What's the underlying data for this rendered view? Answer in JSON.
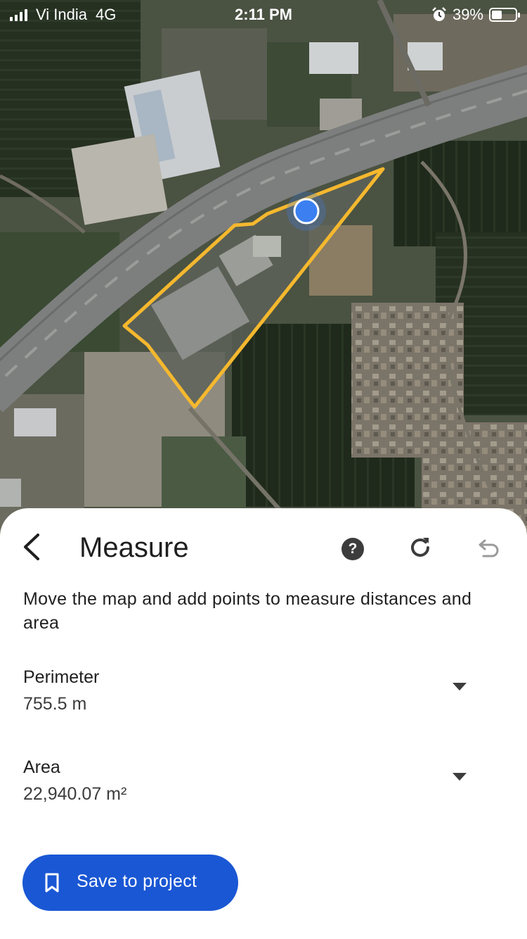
{
  "status_bar": {
    "carrier": "Vi India",
    "network": "4G",
    "time": "2:11 PM",
    "battery": "39%",
    "battery_level": 0.39,
    "icons": [
      "signal-icon",
      "alarm-icon",
      "battery-icon"
    ]
  },
  "map": {
    "style": "satellite",
    "overlay_color": "#f5b82e",
    "location_dot_color": "#3b7ff0"
  },
  "measure": {
    "title": "Measure",
    "instructions": "Move the map and add points to measure distances and area",
    "perimeter_label": "Perimeter",
    "perimeter_value": "755.5 m",
    "area_label": "Area",
    "area_value": "22,940.07 m²",
    "save_label": "Save to project"
  },
  "icons": {
    "back": "back-arrow-icon",
    "help": "help-icon",
    "reset": "refresh-icon",
    "undo": "undo-icon",
    "dropdown": "dropdown-icon",
    "bookmark": "bookmark-icon"
  },
  "colors": {
    "accent": "#1a57d4",
    "text": "#1f1f1f"
  }
}
